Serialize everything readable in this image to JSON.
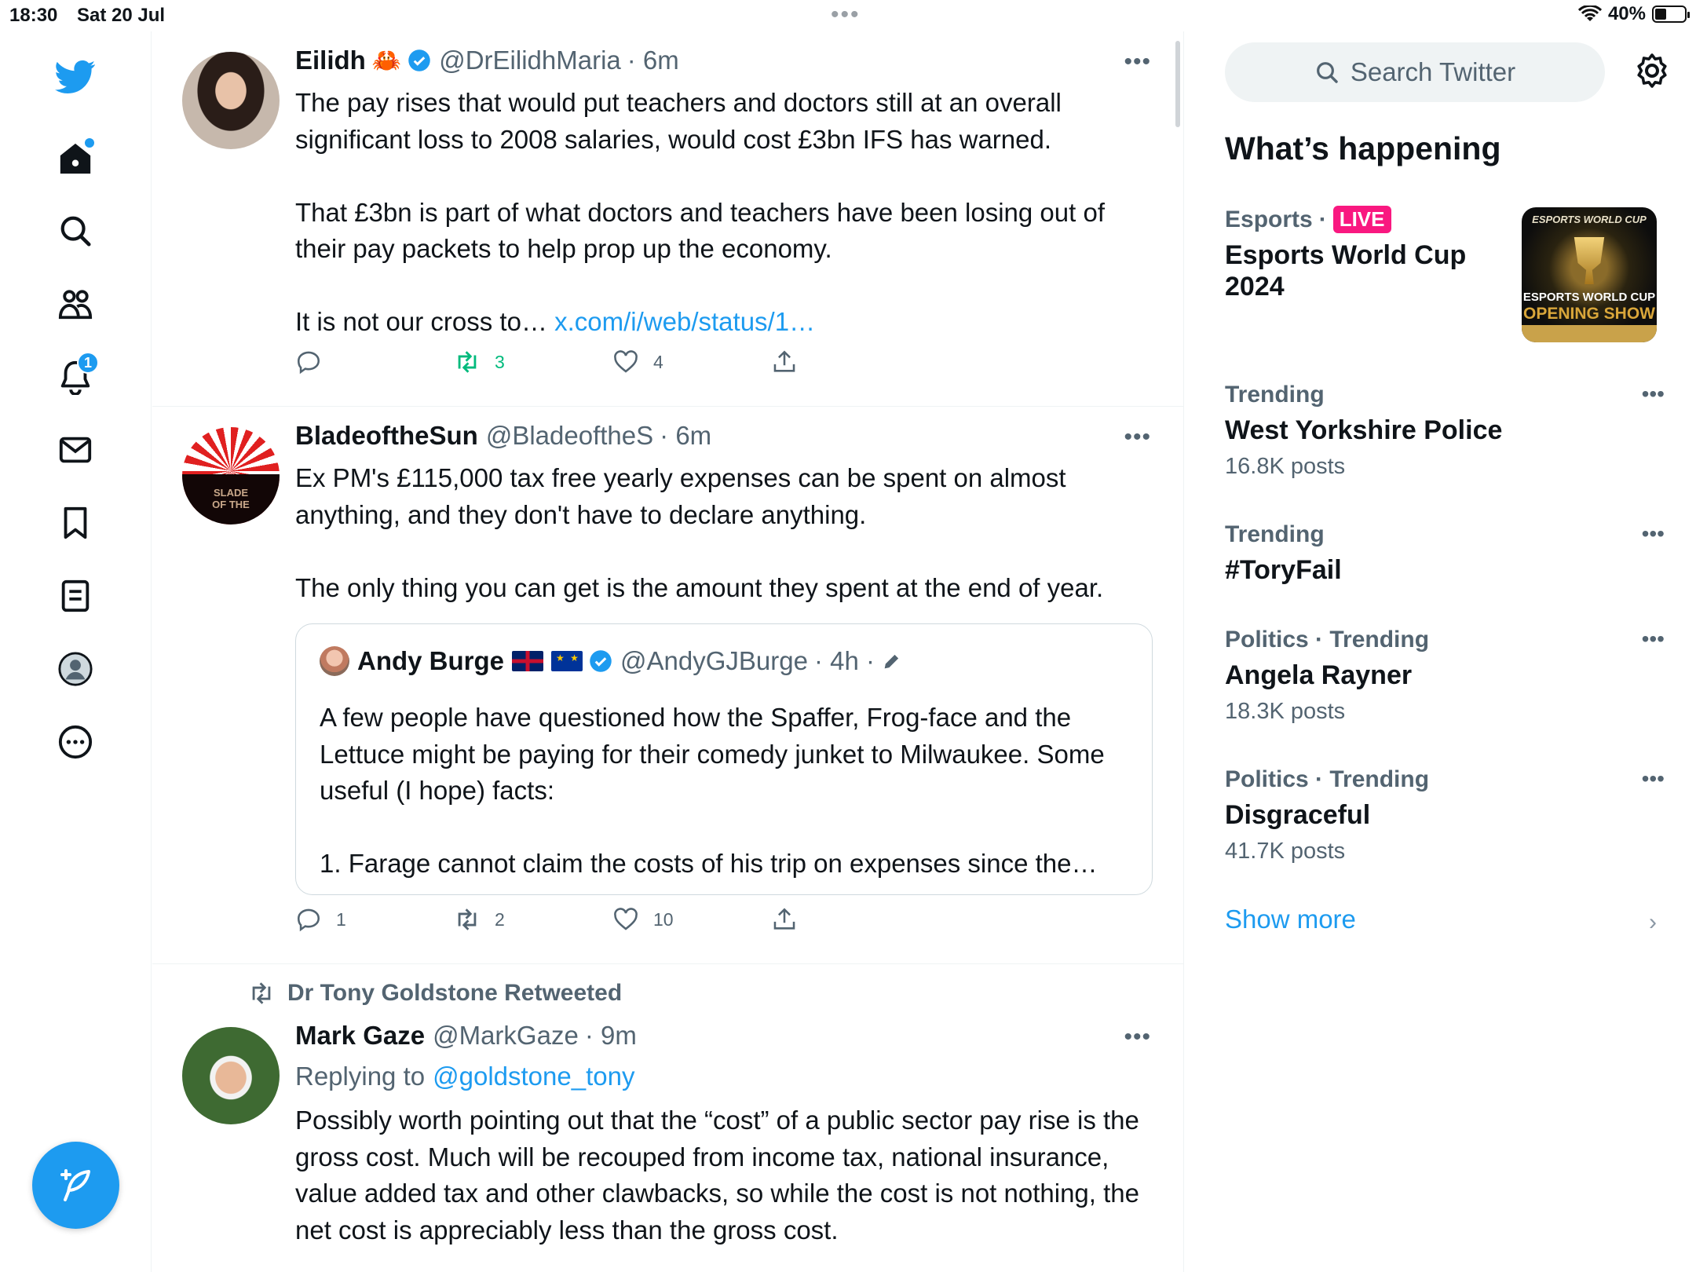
{
  "status_bar": {
    "time": "18:30",
    "date": "Sat 20 Jul",
    "battery": "40%",
    "battery_level": 0.4
  },
  "nav": {
    "notifications_badge": "1",
    "items": [
      "home",
      "explore",
      "communities",
      "notifications",
      "messages",
      "bookmarks",
      "lists",
      "profile",
      "more"
    ]
  },
  "tweets": [
    {
      "name": "Eilidh",
      "emoji": "🦀",
      "verified": true,
      "handle": "@DrEilidhMaria",
      "time": "· 6m",
      "text": "The pay rises that would put teachers and doctors still at an overall significant loss to 2008 salaries, would cost £3bn IFS has warned.\n\nThat £3bn is part of what doctors and teachers have been losing out of their pay packets to help prop up the economy.\n\nIt is not our cross to… ",
      "link": "x.com/i/web/status/1…",
      "replies": "",
      "retweets": "3",
      "likes": "4"
    },
    {
      "name": "BladeoftheSun",
      "handle": "@BladeoftheS",
      "time": "· 6m",
      "text": "Ex PM's £115,000 tax free yearly expenses can be spent on almost anything, and they don't have to declare anything.\n\nThe only thing you can get is the amount they spent at the end of year.",
      "quote": {
        "name": "Andy Burge",
        "verified": true,
        "handle": "@AndyGJBurge",
        "time": "· 4h ·",
        "text": "A few people have questioned how the Spaffer, Frog-face and the Lettuce might be paying for their comedy junket to Milwaukee. Some useful (I hope) facts:\n\n1. Farage cannot claim the costs of his trip on expenses since the…"
      },
      "replies": "1",
      "retweets": "2",
      "likes": "10"
    },
    {
      "retweeted_by": "Dr Tony Goldstone Retweeted",
      "name": "Mark Gaze",
      "handle": "@MarkGaze",
      "time": "· 9m",
      "replying_prefix": "Replying to ",
      "replying_to": "@goldstone_tony",
      "text": "Possibly worth pointing out that the “cost” of a public sector pay rise is the gross cost. Much will be recouped from income tax, national insurance, value added tax and other clawbacks, so while the cost is not nothing, the net cost is appreciably less than the gross cost."
    }
  ],
  "sidebar": {
    "search_placeholder": "Search Twitter",
    "whats_happening": "What’s happening",
    "featured": {
      "category": "Esports",
      "sep": "·",
      "live": "LIVE",
      "title": "Esports World Cup 2024",
      "image_text_top": "ESPORTS WORLD CUP",
      "image_text_mid": "ESPORTS WORLD CUP",
      "image_text_bottom": "OPENING SHOW"
    },
    "trends": [
      {
        "meta": "Trending",
        "title": "West Yorkshire Police",
        "count": "16.8K posts"
      },
      {
        "meta": "Trending",
        "title": "#ToryFail",
        "count": ""
      },
      {
        "meta": "Politics · Trending",
        "title": "Angela Rayner",
        "count": "18.3K posts"
      },
      {
        "meta": "Politics · Trending",
        "title": "Disgraceful",
        "count": "41.7K posts"
      }
    ],
    "show_more": "Show more"
  },
  "colors": {
    "accent": "#1d9bf0",
    "retweet_green": "#00ba7c",
    "live_pink": "#f91880",
    "secondary_text": "#536471"
  }
}
